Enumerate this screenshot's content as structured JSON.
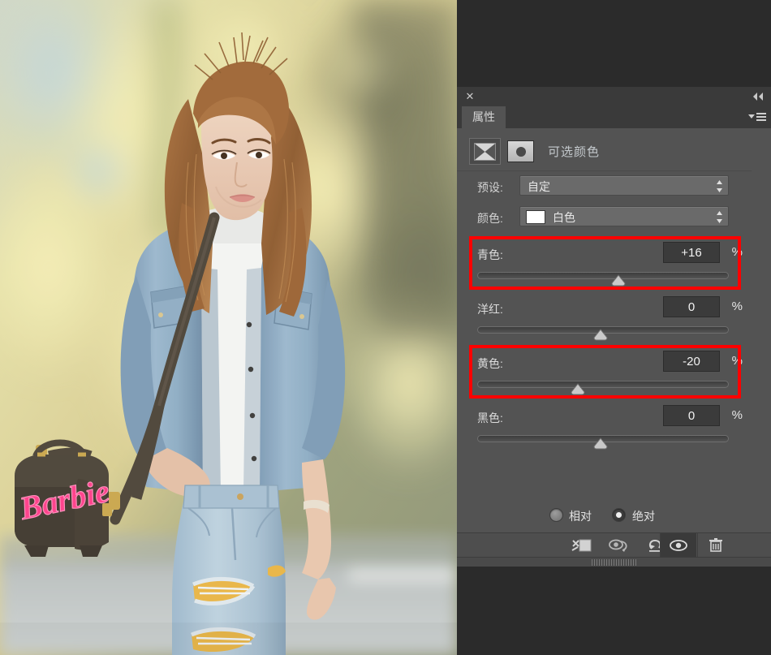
{
  "app": {
    "panel_tab": "属性",
    "close_icon": "close-icon",
    "collapse_icon": "double-chevron-left-icon",
    "menu_icon": "panel-menu-icon"
  },
  "header": {
    "adjustment_icon": "selective-color-adjustment-icon",
    "mask_icon": "layer-mask-thumbnail-icon",
    "title": "可选颜色"
  },
  "preset": {
    "label": "预设:",
    "value": "自定",
    "stepper_icon": "updown-arrows-icon"
  },
  "color": {
    "label": "颜色:",
    "value": "白色",
    "swatch_hex": "#ffffff",
    "stepper_icon": "updown-arrows-icon"
  },
  "sliders": [
    {
      "name": "cyan",
      "label": "青色:",
      "value": "+16",
      "unit": "%",
      "pos_pct": 56,
      "highlighted": true
    },
    {
      "name": "magenta",
      "label": "洋红:",
      "value": "0",
      "unit": "%",
      "pos_pct": 49,
      "highlighted": false
    },
    {
      "name": "yellow",
      "label": "黄色:",
      "value": "-20",
      "unit": "%",
      "pos_pct": 40,
      "highlighted": true
    },
    {
      "name": "black",
      "label": "黑色:",
      "value": "0",
      "unit": "%",
      "pos_pct": 49,
      "highlighted": false
    }
  ],
  "method": {
    "relative_label": "相对",
    "absolute_label": "绝对",
    "selected": "绝对"
  },
  "toolbar": {
    "buttons": [
      {
        "name": "clip-to-layer-icon",
        "active": false
      },
      {
        "name": "view-previous-state-icon",
        "active": false
      },
      {
        "name": "reset-icon",
        "active": false
      },
      {
        "name": "toggle-visibility-icon",
        "active": true
      },
      {
        "name": "delete-icon",
        "active": false
      }
    ]
  },
  "colors": {
    "highlight_red": "#fe0000",
    "panel_bg": "#535353",
    "chrome_bg": "#3a3a3a",
    "workspace_bg": "#2b2b2b"
  },
  "photo": {
    "subject": "young woman in denim shirt with white tank top and ripped jeans",
    "bag_text": "Barbie",
    "bag_text_color": "#ff3d8b"
  }
}
